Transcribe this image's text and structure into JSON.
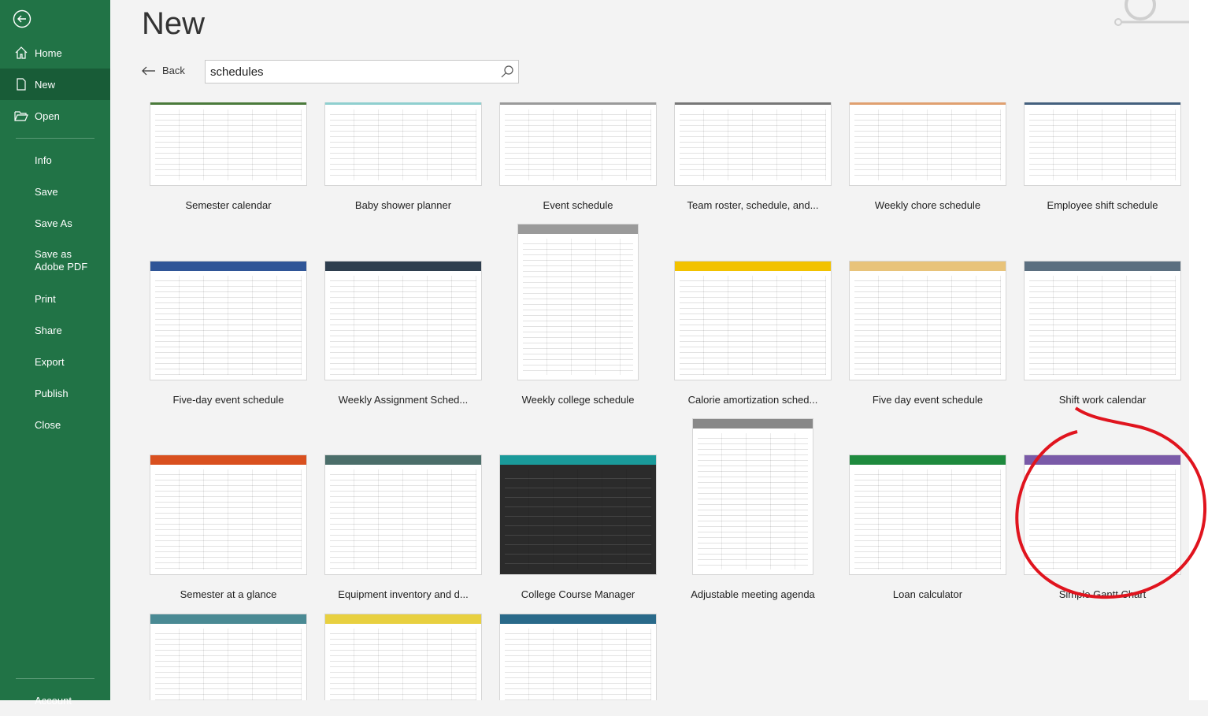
{
  "sidebar": {
    "back": "back-arrow",
    "items": [
      {
        "label": "Home",
        "icon": "home-icon"
      },
      {
        "label": "New",
        "icon": "new-file-icon",
        "selected": true
      },
      {
        "label": "Open",
        "icon": "open-folder-icon"
      },
      {
        "label": "Info"
      },
      {
        "label": "Save"
      },
      {
        "label": "Save As"
      },
      {
        "label": "Save as Adobe PDF"
      },
      {
        "label": "Print"
      },
      {
        "label": "Share"
      },
      {
        "label": "Export"
      },
      {
        "label": "Publish"
      },
      {
        "label": "Close"
      },
      {
        "label": "Account"
      }
    ]
  },
  "header": {
    "title": "New",
    "back_label": "Back",
    "search_value": "schedules"
  },
  "colors": {
    "sidebar": "#217346",
    "selected": "#185c37",
    "annotation": "#e0141e"
  },
  "templates": [
    {
      "name": "Semester calendar",
      "accent": "#4a7a3b"
    },
    {
      "name": "Baby shower planner",
      "accent": "#8fcfcf"
    },
    {
      "name": "Event schedule",
      "accent": "#9a9a9a"
    },
    {
      "name": "Team roster, schedule, and...",
      "accent": "#777777"
    },
    {
      "name": "Weekly chore schedule",
      "accent": "#e0a070"
    },
    {
      "name": "Employee shift schedule",
      "accent": "#44607e"
    },
    {
      "name": "Five-day event schedule",
      "accent": "#2f5597"
    },
    {
      "name": "Weekly Assignment Sched...",
      "accent": "#2e3e4e"
    },
    {
      "name": "Weekly college schedule",
      "accent": "#9a9a9a"
    },
    {
      "name": "Calorie amortization sched...",
      "accent": "#f2c200"
    },
    {
      "name": "Five day event schedule",
      "accent": "#e8c37a"
    },
    {
      "name": "Shift work calendar",
      "accent": "#5b6f80"
    },
    {
      "name": "Semester at a glance",
      "accent": "#d9501f"
    },
    {
      "name": "Equipment inventory and d...",
      "accent": "#4b6e6a"
    },
    {
      "name": "College Course Manager",
      "accent": "#1a9a9a"
    },
    {
      "name": "Adjustable meeting agenda",
      "accent": "#888888"
    },
    {
      "name": "Loan calculator",
      "accent": "#1e8a3e"
    },
    {
      "name": "Simple Gantt Chart",
      "accent": "#7a5aa8"
    },
    {
      "name": "",
      "accent": "#4a8a94"
    },
    {
      "name": "",
      "accent": "#e8d040"
    },
    {
      "name": "",
      "accent": "#2a6a8a"
    }
  ]
}
